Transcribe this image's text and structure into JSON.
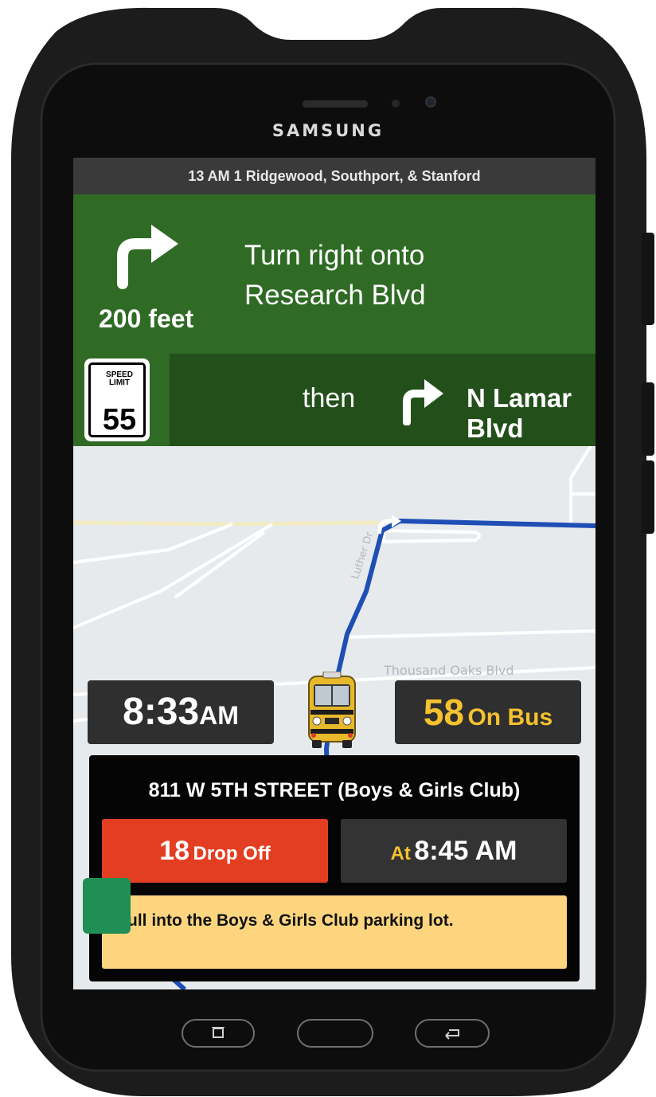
{
  "device": {
    "brand": "SAMSUNG"
  },
  "route": {
    "name": "13 AM 1 Ridgewood, Southport, & Stanford"
  },
  "navigation": {
    "maneuver_icon": "turn-right-arrow-icon",
    "distance": "200 feet",
    "instruction_line1": "Turn right onto",
    "instruction_line2": "Research Blvd",
    "then_label": "then",
    "next_maneuver_icon": "turn-right-arrow-icon",
    "next_street": "N Lamar Blvd"
  },
  "speed_limit": {
    "label_line1": "SPEED",
    "label_line2": "LIMIT",
    "value": "55"
  },
  "map": {
    "street_labels": [
      "Luther Dr",
      "Thousand Oaks Blvd"
    ],
    "route_color": "#1f4fb5"
  },
  "status": {
    "time": "8:33",
    "time_suffix": "AM",
    "on_bus_count": "58",
    "on_bus_label": "On Bus",
    "vehicle_icon": "school-bus-icon"
  },
  "stop": {
    "address": "811 W 5TH STREET (Boys & Girls Club)",
    "dropoff_count": "18",
    "dropoff_label": "Drop Off",
    "at_label": "At",
    "at_time": "8:45 AM",
    "note": "Pull into the Boys & Girls Club parking lot."
  },
  "colors": {
    "nav_green": "#2f6b24",
    "nav_green_dark": "#234f1b",
    "accent_yellow": "#f5c12e",
    "dropoff_red": "#e43e22",
    "note_bg": "#fdd57e"
  },
  "hardware_keys": [
    "recent-apps-icon",
    "home-button",
    "back-icon"
  ]
}
